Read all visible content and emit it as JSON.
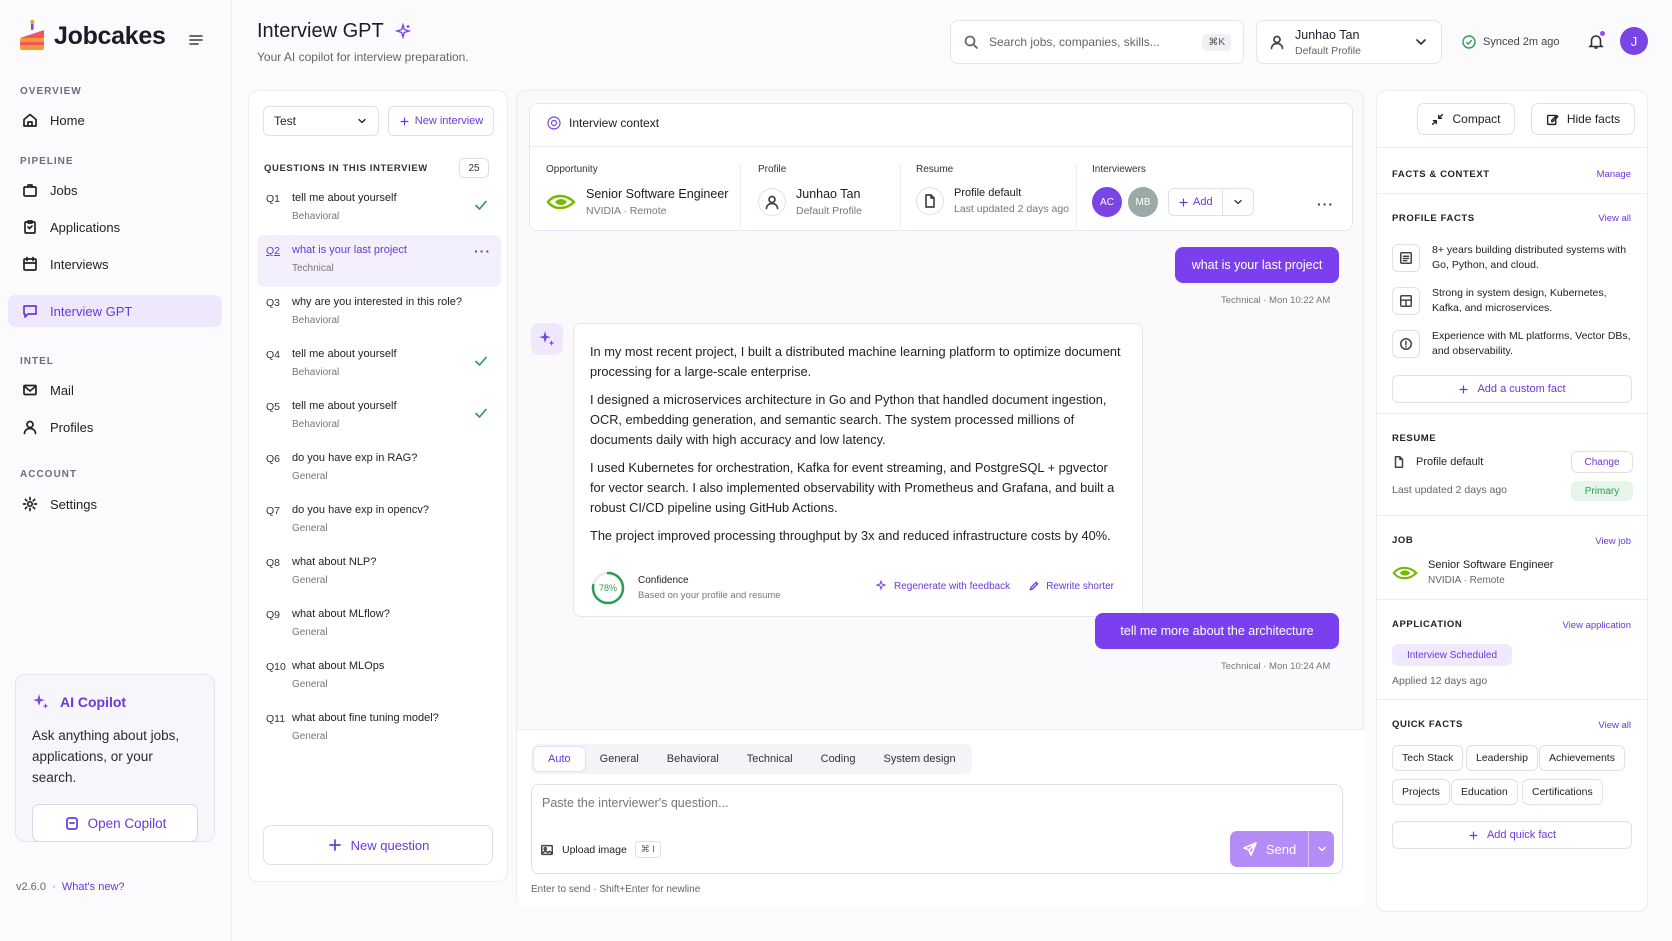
{
  "app": {
    "name": "Jobcakes",
    "version": "v2.6.0",
    "whats_new": "What's new?"
  },
  "nav": {
    "sections": [
      "OVERVIEW",
      "PIPELINE",
      "INTEL",
      "ACCOUNT"
    ],
    "items": [
      {
        "label": "Home",
        "icon": "home-icon"
      },
      {
        "label": "Jobs",
        "icon": "briefcase-icon"
      },
      {
        "label": "Applications",
        "icon": "clipboard-icon"
      },
      {
        "label": "Interviews",
        "icon": "calendar-icon"
      },
      {
        "label": "Interview GPT",
        "icon": "chat-icon"
      },
      {
        "label": "Mail",
        "icon": "mail-icon"
      },
      {
        "label": "Profiles",
        "icon": "user-icon"
      },
      {
        "label": "Settings",
        "icon": "gear-icon"
      }
    ]
  },
  "copilot_card": {
    "title": "AI Copilot",
    "description": "Ask anything about jobs, applications, or your search.",
    "button": "Open Copilot"
  },
  "header": {
    "title": "Interview GPT",
    "subtitle": "Your AI copilot for interview preparation.",
    "search_placeholder": "Search jobs, companies, skills...",
    "search_shortcut": "⌘K",
    "profile_name": "Junhao Tan",
    "profile_sub": "Default Profile",
    "synced": "Synced 2m ago",
    "avatar_initial": "J"
  },
  "questions": {
    "selected_interview": "Test",
    "new_interview": "New interview",
    "heading": "QUESTIONS IN THIS INTERVIEW",
    "count": "25",
    "items": [
      {
        "num": "Q1",
        "text": "tell me about yourself",
        "cat": "Behavioral",
        "done": true
      },
      {
        "num": "Q2",
        "text": "what is your last project",
        "cat": "Technical",
        "active": true
      },
      {
        "num": "Q3",
        "text": "why are you interested in this role?",
        "cat": "Behavioral"
      },
      {
        "num": "Q4",
        "text": "tell me about yourself",
        "cat": "Behavioral",
        "done": true
      },
      {
        "num": "Q5",
        "text": "tell me about yourself",
        "cat": "Behavioral",
        "done": true
      },
      {
        "num": "Q6",
        "text": "do you have exp in RAG?",
        "cat": "General"
      },
      {
        "num": "Q7",
        "text": "do you have exp in opencv?",
        "cat": "General"
      },
      {
        "num": "Q8",
        "text": "what about NLP?",
        "cat": "General"
      },
      {
        "num": "Q9",
        "text": "what about MLflow?",
        "cat": "General"
      },
      {
        "num": "Q10",
        "text": "what about MLOps",
        "cat": "General"
      },
      {
        "num": "Q11",
        "text": "what about fine tuning model?",
        "cat": "General"
      }
    ],
    "new_question": "New question"
  },
  "context": {
    "title": "Interview context",
    "opportunity_label": "Opportunity",
    "job_title": "Senior Software Engineer",
    "job_sub": "NVIDIA · Remote",
    "profile_label": "Profile",
    "profile_name": "Junhao Tan",
    "profile_sub": "Default Profile",
    "resume_label": "Resume",
    "resume_name": "Profile default",
    "resume_sub": "Last updated 2 days ago",
    "interviewers_label": "Interviewers",
    "interviewers": [
      {
        "initials": "AC",
        "color": "#7b44e6"
      },
      {
        "initials": "MB",
        "color": "#9aaaa6"
      }
    ],
    "add": "Add"
  },
  "chat": {
    "msg1": "what is your last project",
    "msg1_meta": "Technical  ·  Mon 10:22 AM",
    "answer": [
      "In my most recent project, I built a distributed machine learning platform to optimize document processing for a large-scale enterprise.",
      "I designed a microservices architecture in Go and Python that handled document ingestion, OCR, embedding generation, and semantic search. The system processed millions of documents daily with high accuracy and low latency.",
      "I used Kubernetes for orchestration, Kafka for event streaming, and PostgreSQL + pgvector for vector search. I also implemented observability with Prometheus and Grafana, and built a robust CI/CD pipeline using GitHub Actions.",
      "The project improved processing throughput by 3x and reduced infrastructure costs by 40%."
    ],
    "confidence_value": 78,
    "confidence_text": "78%",
    "confidence_label": "Confidence",
    "confidence_sub": "Based on your profile and resume",
    "regenerate": "Regenerate with feedback",
    "rewrite": "Rewrite shorter",
    "msg2": "tell me more about the architecture",
    "msg2_meta": "Technical  ·  Mon 10:24 AM"
  },
  "composer": {
    "tabs": [
      "Auto",
      "General",
      "Behavioral",
      "Technical",
      "Coding",
      "System design"
    ],
    "placeholder": "Paste the interviewer's question...",
    "upload": "Upload image",
    "upload_shortcut": "⌘ I",
    "send": "Send",
    "hint": "Enter to send · Shift+Enter for newline"
  },
  "facts": {
    "compact": "Compact",
    "hide_facts": "Hide facts",
    "heading": "FACTS & CONTEXT",
    "manage": "Manage",
    "profile_facts_heading": "PROFILE FACTS",
    "view_all": "View all",
    "profile_facts": [
      "8+ years building distributed systems with Go, Python, and cloud.",
      "Strong in system design, Kubernetes, Kafka, and microservices.",
      "Experience with ML platforms, Vector DBs, and observability."
    ],
    "add_custom": "Add a custom fact",
    "resume_heading": "RESUME",
    "resume_name": "Profile default",
    "resume_change": "Change",
    "resume_updated": "Last updated 2 days ago",
    "resume_primary": "Primary",
    "job_heading": "JOB",
    "view_job": "View job",
    "job_title": "Senior Software Engineer",
    "job_sub": "NVIDIA · Remote",
    "application_heading": "APPLICATION",
    "view_application": "View application",
    "application_status": "Interview Scheduled",
    "application_applied": "Applied 12 days ago",
    "quick_heading": "QUICK FACTS",
    "quick_view_all": "View all",
    "quick_chips": [
      "Tech Stack",
      "Leadership",
      "Achievements",
      "Projects",
      "Education",
      "Certifications"
    ],
    "add_quick": "Add quick fact"
  },
  "colors": {
    "accent": "#7b3ff0",
    "success": "#2e9c56",
    "nvidia": "#76b900"
  }
}
